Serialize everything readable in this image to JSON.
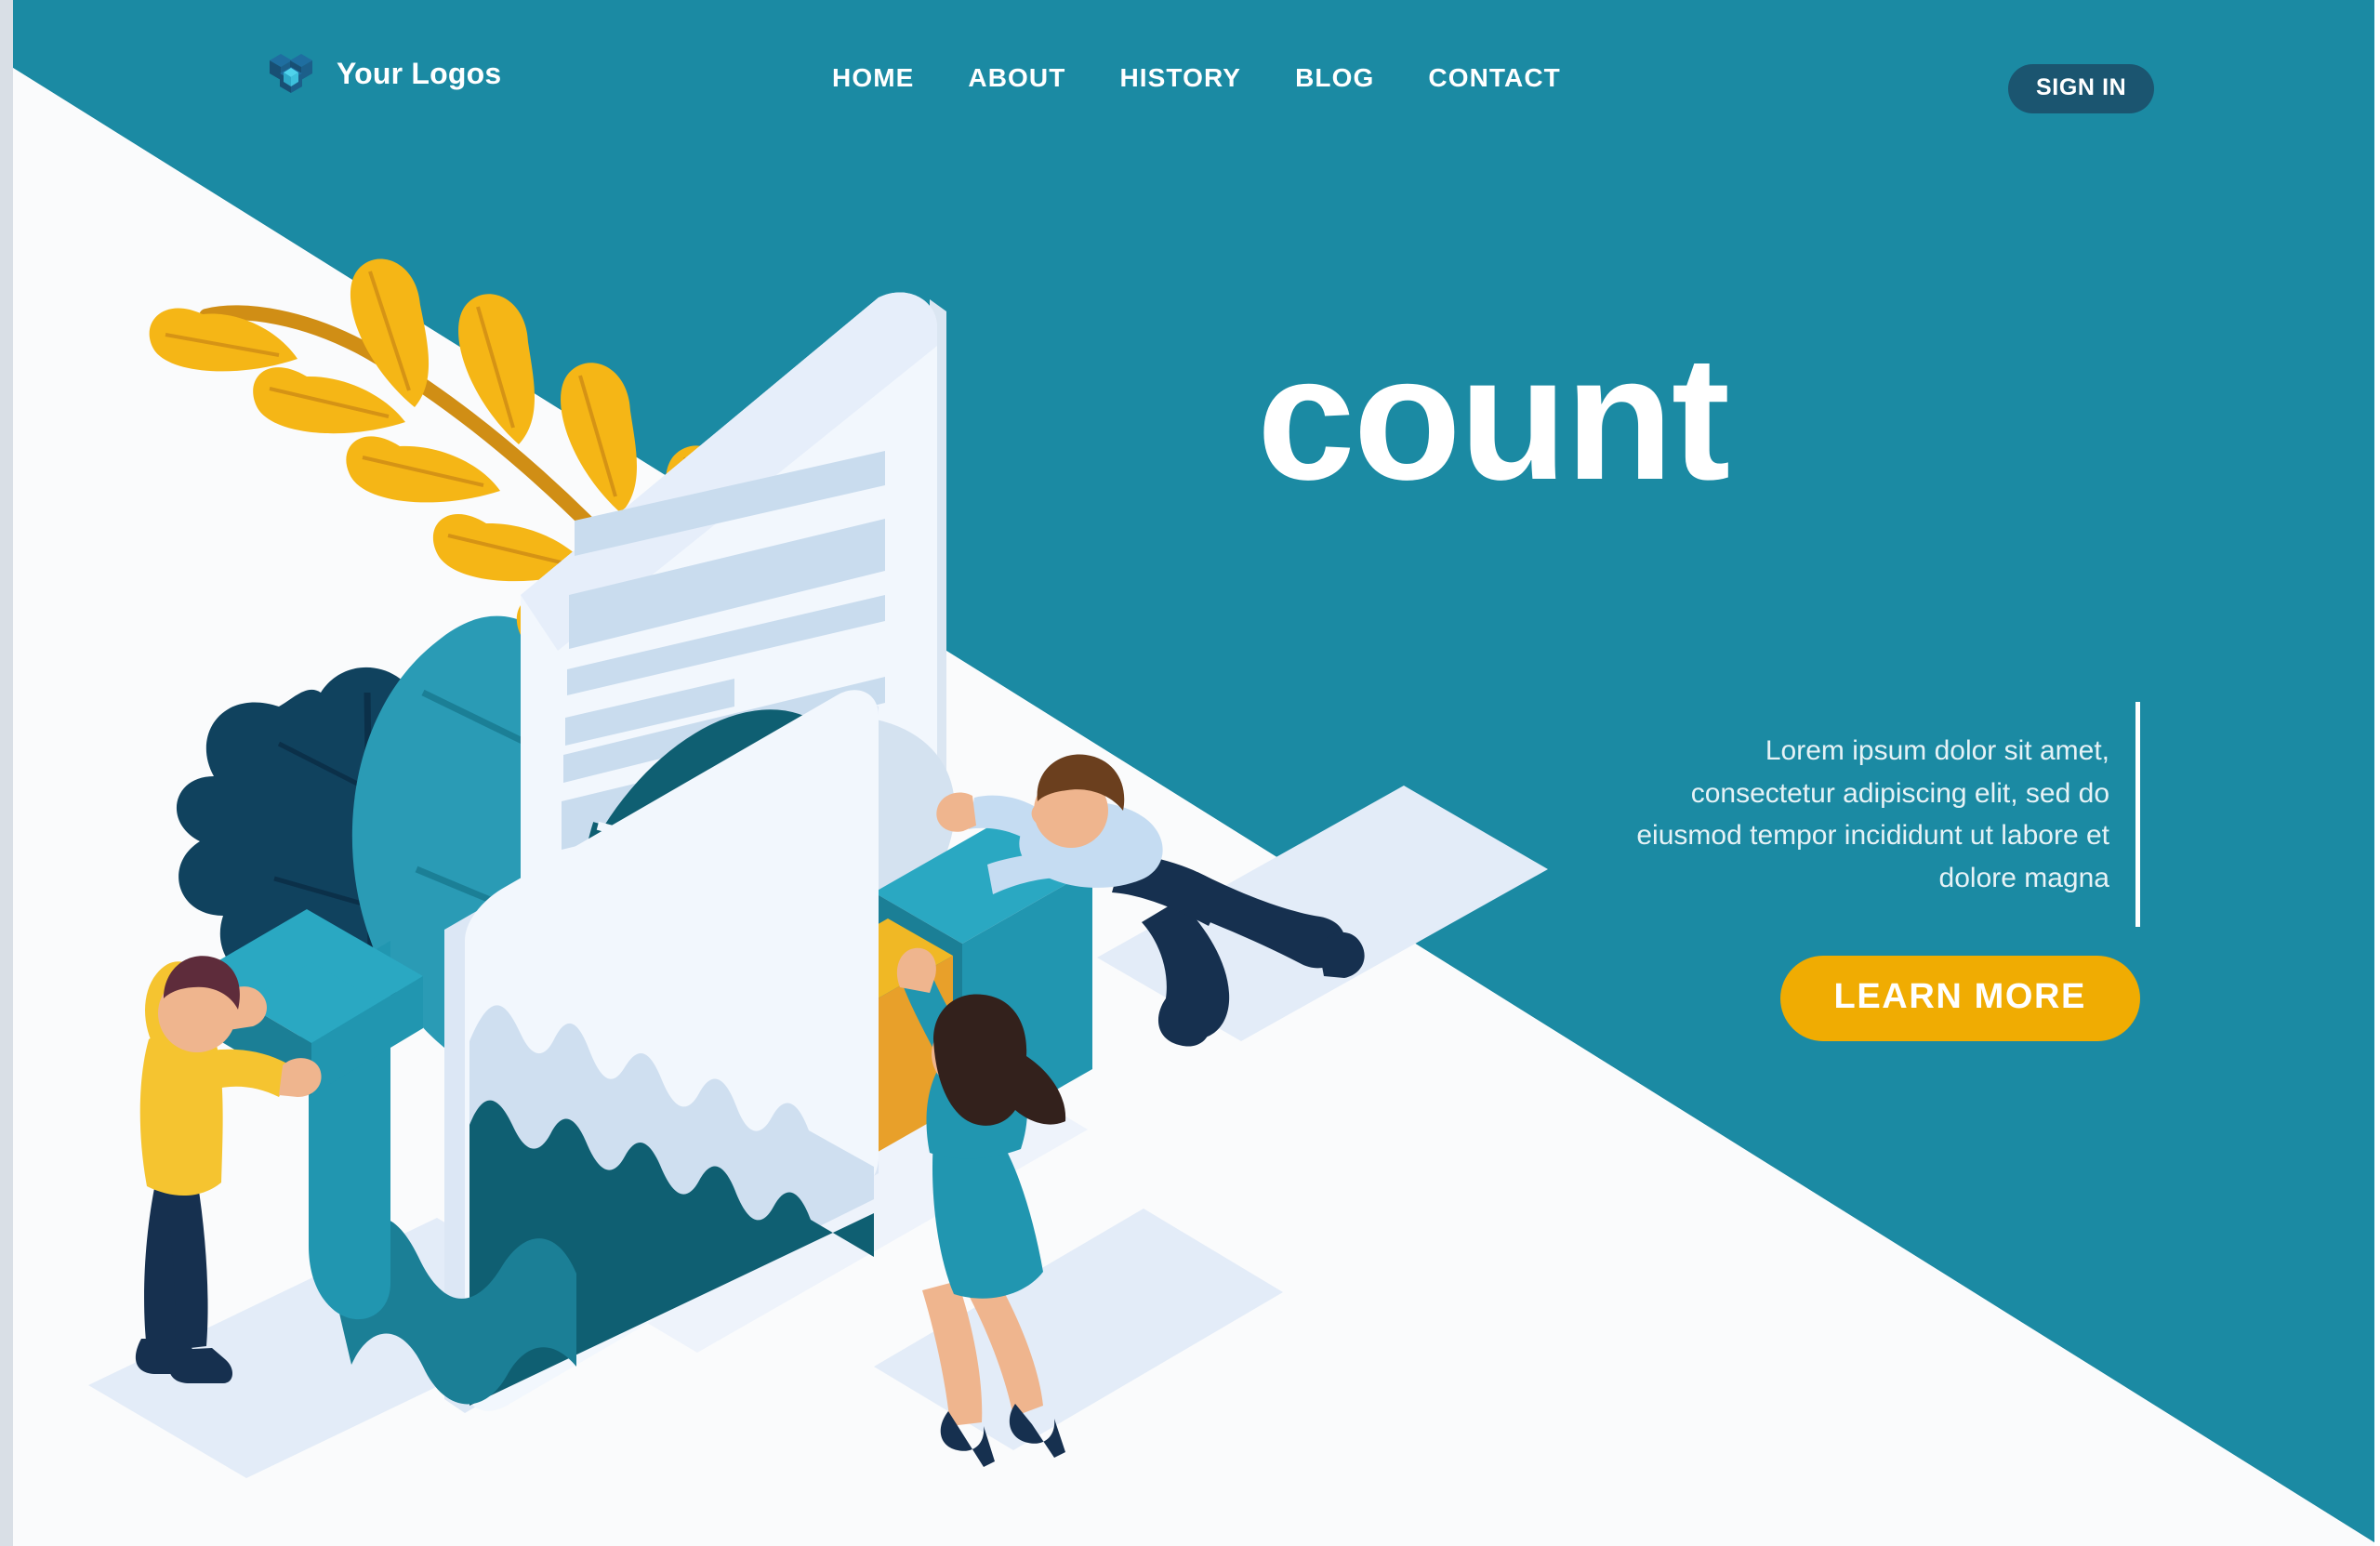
{
  "brand": {
    "name": "Your Logos",
    "logo_icon": "isometric-cube-gear-icon",
    "logo_colors": {
      "dark": "#1c4f75",
      "mid": "#1f6ea0",
      "light": "#49c3e0"
    }
  },
  "nav": {
    "items": [
      {
        "label": "HOME"
      },
      {
        "label": "ABOUT"
      },
      {
        "label": "HISTORY"
      },
      {
        "label": "BLOG"
      },
      {
        "label": "CONTACT"
      }
    ]
  },
  "account": {
    "signin_label": "SIGN IN"
  },
  "hero": {
    "title": "count",
    "body": "Lorem ipsum dolor sit amet, consectetur adipiscing elit, sed do eiusmod tempor incididunt ut labore et dolore magna",
    "cta_label": "LEARN MORE"
  },
  "theme": {
    "teal": "#1b8aa3",
    "deep_teal": "#0f5f72",
    "navy": "#1b5570",
    "amber": "#f0ac02",
    "gold": "#e8a02a",
    "white": "#ffffff",
    "offwhite": "#fafbfc",
    "pale_blue": "#cfdff0",
    "card_blue": "#eef4fb"
  },
  "illustration": {
    "name": "isometric-business-analytics-illustration",
    "elements": [
      {
        "name": "gold-fern-plant",
        "color": "#f0ac02"
      },
      {
        "name": "teal-leaf-plant",
        "color": "#2a9bb5"
      },
      {
        "name": "navy-oak-leaf",
        "color": "#10425e"
      },
      {
        "name": "document-card",
        "color": "#eef4fb"
      },
      {
        "name": "donut-chart",
        "colors": [
          "#0f5f72",
          "#d4e2f0"
        ]
      },
      {
        "name": "area-chart-card",
        "colors": [
          "#0f5f72",
          "#cfdff0"
        ]
      },
      {
        "name": "teal-bar-cube",
        "color": "#2196b0"
      },
      {
        "name": "gold-bar-cube",
        "color": "#e8a02a"
      },
      {
        "name": "growth-arrow",
        "color": "#2196b0"
      },
      {
        "name": "man-pushing-cube",
        "shirt": "#c5dcf2",
        "pants": "#16304f"
      },
      {
        "name": "woman-pushing-chart",
        "dress": "#2196b0",
        "hair": "#33211c"
      },
      {
        "name": "man-lifting-arrow",
        "sweater": "#f5c430",
        "pants": "#16304f"
      }
    ]
  }
}
